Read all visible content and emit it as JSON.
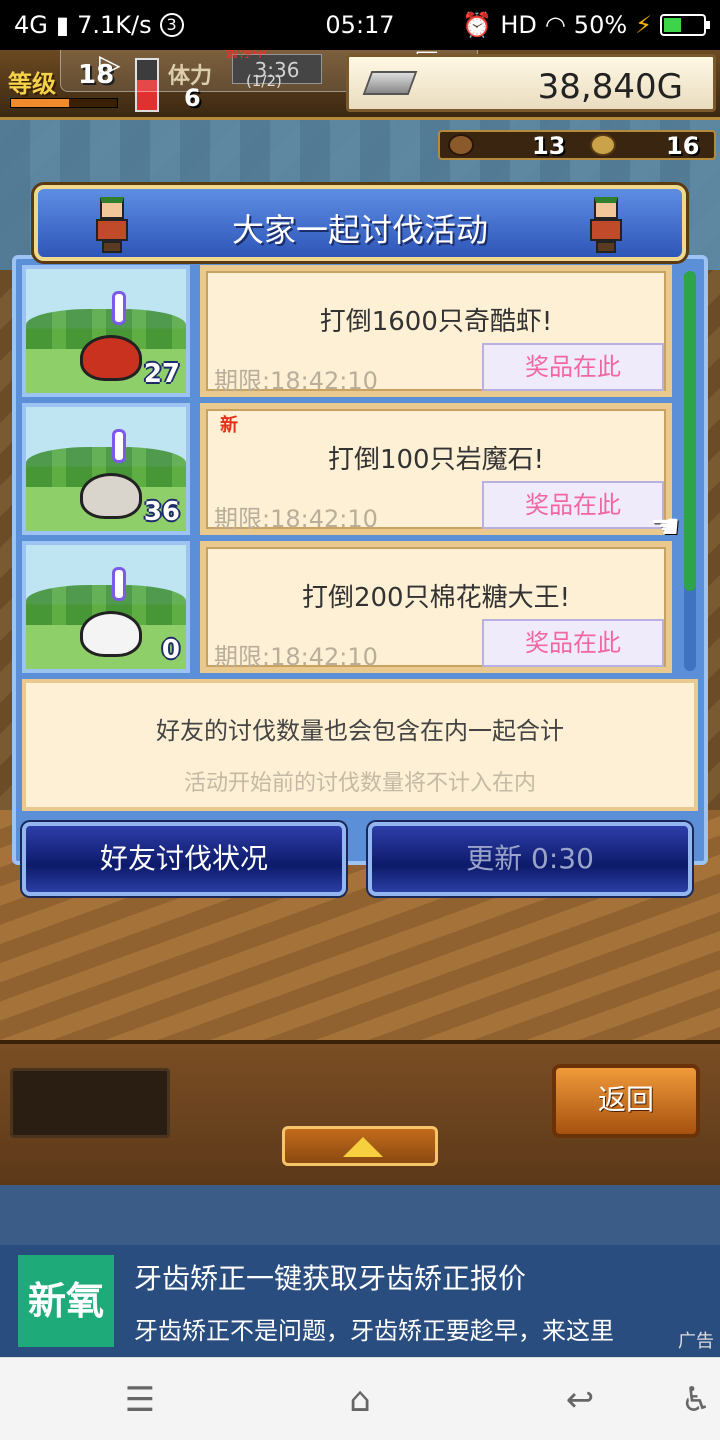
{
  "status_bar": {
    "network": "4G",
    "speed": "7.1K/s",
    "notif_count": "3",
    "time": "05:17",
    "hd": "HD",
    "battery": "50%",
    "battery_level": 0.5
  },
  "hud": {
    "level_label": "等级",
    "level": "18",
    "level_progress": 0.55,
    "stamina_label": "体力",
    "stamina": "6",
    "stamina_level": 0.6,
    "timer": "3:36",
    "page_indicator": "(1/2)",
    "red_caption": "暂停中",
    "gold": "38,840G",
    "res1": "13",
    "res2": "16"
  },
  "dialog": {
    "title": "大家一起讨伐活动",
    "quests": [
      {
        "count": "27",
        "title": "打倒1600只奇酷虾!",
        "new_badge": "",
        "deadline": "期限:18:42:10",
        "prize": "奖品在此",
        "monster_color": "#c8321e"
      },
      {
        "count": "36",
        "title": "打倒100只岩魔石!",
        "new_badge": "新",
        "deadline": "期限:18:42:10",
        "prize": "奖品在此",
        "monster_color": "#d9d4cc"
      },
      {
        "count": "0",
        "title": "打倒200只棉花糖大王!",
        "new_badge": "",
        "deadline": "期限:18:42:10",
        "prize": "奖品在此",
        "monster_color": "#f4f4f4"
      }
    ],
    "info_main": "好友的讨伐数量也会包含在内一起合计",
    "info_sub": "活动开始前的讨伐数量将不计入在内",
    "friend_button": "好友讨伐状况",
    "refresh_button": "更新 0:30"
  },
  "bottom": {
    "back_button": "返回"
  },
  "ad": {
    "logo": "新氧",
    "title": "牙齿矫正一键获取牙齿矫正报价",
    "description": "牙齿矫正不是问题，牙齿矫正要趁早，来这里",
    "tag": "广告"
  },
  "icons": {
    "menu": "menu-icon",
    "home": "home-icon",
    "back": "back-icon",
    "accessibility": "accessibility-icon"
  }
}
